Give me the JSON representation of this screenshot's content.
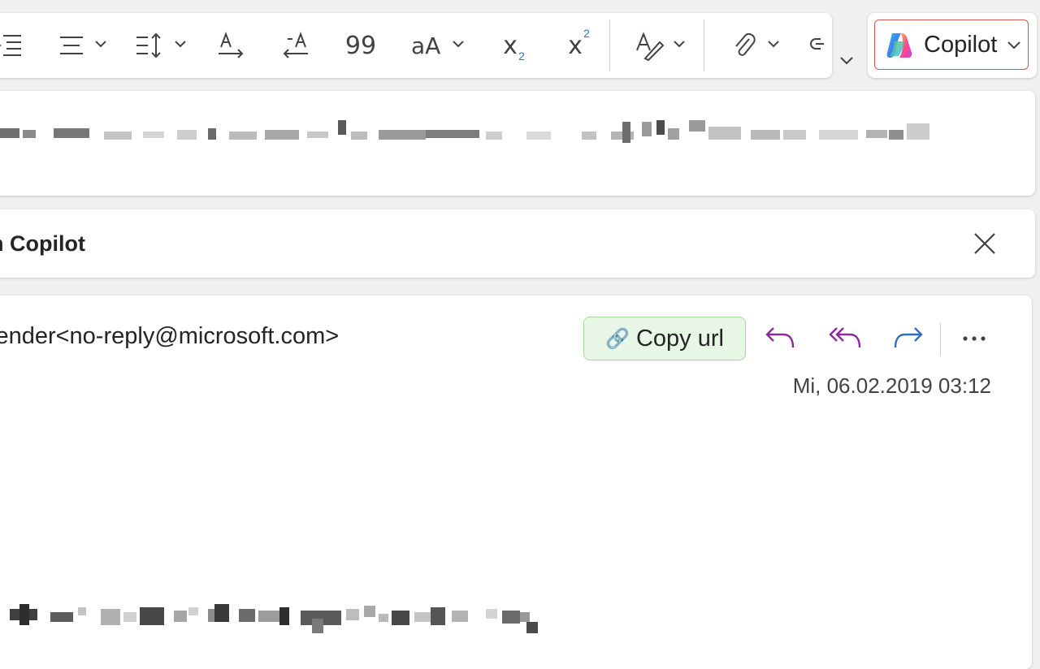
{
  "toolbar": {
    "quote_glyph": "99",
    "font_size_glyph": "aA",
    "subscript_base": "x",
    "subscript_mark": "2",
    "superscript_base": "x",
    "superscript_mark": "2",
    "icons": [
      "indent-icon",
      "align-icon",
      "line-spacing-icon",
      "text-direction-ltr-icon",
      "text-direction-rtl-icon",
      "quote-icon",
      "change-case-icon",
      "subscript-icon",
      "superscript-icon",
      "styles-icon",
      "attach-icon",
      "link-icon",
      "more-options-chevron-icon"
    ]
  },
  "copilot": {
    "label": "Copilot",
    "border_color": "#d1594f"
  },
  "copilot_bar": {
    "title": "h Copilot"
  },
  "message": {
    "sender": "lender<no-reply@microsoft.com>",
    "copy_url_label": "Copy url",
    "copy_url_icon": "🔗",
    "date": "Mi, 06.02.2019 03:12",
    "action_colors": {
      "reply": "#8a2a9b",
      "reply_all": "#8a2a9b",
      "forward": "#2f6fc6"
    }
  }
}
